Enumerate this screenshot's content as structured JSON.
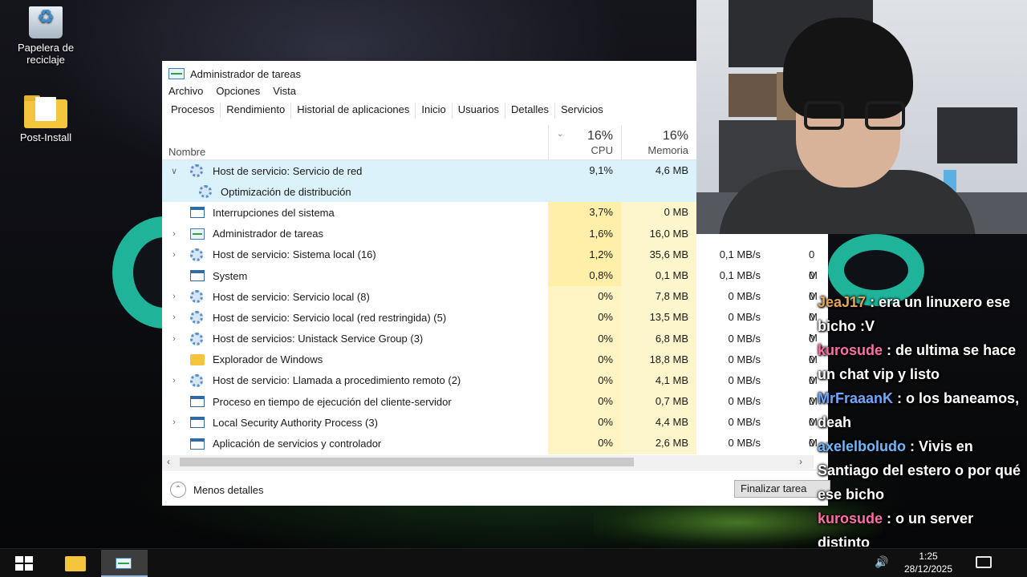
{
  "desktop": {
    "icons": [
      {
        "label": "Papelera de reciclaje",
        "icon": "recycle-bin-icon"
      },
      {
        "label": "Post-Install",
        "icon": "folder-icon"
      }
    ]
  },
  "taskmgr": {
    "title": "Administrador de tareas",
    "menu": [
      "Archivo",
      "Opciones",
      "Vista"
    ],
    "tabs": [
      "Procesos",
      "Rendimiento",
      "Historial de aplicaciones",
      "Inicio",
      "Usuarios",
      "Detalles",
      "Servicios"
    ],
    "active_tab": "Procesos",
    "columns": {
      "name": "Nombre",
      "cpu_pct": "16%",
      "cpu_label": "CPU",
      "mem_pct": "16%",
      "mem_label": "Memoria"
    },
    "rows": [
      {
        "expand": "v",
        "icon": "gear-icon",
        "name": "Host de servicio: Servicio de red",
        "cpu": "9,1%",
        "mem": "4,6 MB",
        "disk": "",
        "net": "",
        "state": "selected"
      },
      {
        "expand": "",
        "icon": "gear-icon",
        "name": "Optimización de distribución",
        "cpu": "",
        "mem": "",
        "disk": "",
        "net": "",
        "state": "sub"
      },
      {
        "expand": "",
        "icon": "window-icon",
        "name": "Interrupciones del sistema",
        "cpu": "3,7%",
        "mem": "0 MB",
        "disk": "",
        "net": "",
        "state": ""
      },
      {
        "expand": ">",
        "icon": "taskmgr-icon",
        "name": "Administrador de tareas",
        "cpu": "1,6%",
        "mem": "16,0 MB",
        "disk": "",
        "net": "",
        "state": ""
      },
      {
        "expand": ">",
        "icon": "gear-icon",
        "name": "Host de servicio: Sistema local (16)",
        "cpu": "1,2%",
        "mem": "35,6 MB",
        "disk": "0,1 MB/s",
        "net": "0 M",
        "state": ""
      },
      {
        "expand": "",
        "icon": "window-icon",
        "name": "System",
        "cpu": "0,8%",
        "mem": "0,1 MB",
        "disk": "0,1 MB/s",
        "net": "0 M",
        "state": ""
      },
      {
        "expand": ">",
        "icon": "gear-icon",
        "name": "Host de servicio: Servicio local (8)",
        "cpu": "0%",
        "mem": "7,8 MB",
        "disk": "0 MB/s",
        "net": "0 M",
        "state": ""
      },
      {
        "expand": ">",
        "icon": "gear-icon",
        "name": "Host de servicio: Servicio local (red restringida) (5)",
        "cpu": "0%",
        "mem": "13,5 MB",
        "disk": "0 MB/s",
        "net": "0 M",
        "state": ""
      },
      {
        "expand": ">",
        "icon": "gear-icon",
        "name": "Host de servicios: Unistack Service Group (3)",
        "cpu": "0%",
        "mem": "6,8 MB",
        "disk": "0 MB/s",
        "net": "0 M",
        "state": ""
      },
      {
        "expand": "",
        "icon": "folder-icon",
        "name": "Explorador de Windows",
        "cpu": "0%",
        "mem": "18,8 MB",
        "disk": "0 MB/s",
        "net": "0 M",
        "state": ""
      },
      {
        "expand": ">",
        "icon": "gear-icon",
        "name": "Host de servicio: Llamada a procedimiento remoto (2)",
        "cpu": "0%",
        "mem": "4,1 MB",
        "disk": "0 MB/s",
        "net": "0 M",
        "state": ""
      },
      {
        "expand": "",
        "icon": "window-icon",
        "name": "Proceso en tiempo de ejecución del cliente-servidor",
        "cpu": "0%",
        "mem": "0,7 MB",
        "disk": "0 MB/s",
        "net": "0 M",
        "state": ""
      },
      {
        "expand": ">",
        "icon": "window-icon",
        "name": "Local Security Authority Process (3)",
        "cpu": "0%",
        "mem": "4,4 MB",
        "disk": "0 MB/s",
        "net": "0 M",
        "state": ""
      },
      {
        "expand": "",
        "icon": "window-icon",
        "name": "Aplicación de servicios y controlador",
        "cpu": "0%",
        "mem": "2,6 MB",
        "disk": "0 MB/s",
        "net": "0 M",
        "state": ""
      }
    ],
    "footer": {
      "less_details": "Menos detalles",
      "end_task": "Finalizar tarea"
    }
  },
  "chat": [
    {
      "user": "JeaJ17",
      "color": "#e8a55a",
      "text": "era un linuxero ese bicho :V"
    },
    {
      "user": "kurosude",
      "color": "#ff6fa8",
      "text": "de ultima se hace un chat vip y listo"
    },
    {
      "user": "MrFraaanK",
      "color": "#6fa8ff",
      "text": "o los baneamos, deah"
    },
    {
      "user": "axelelboludo",
      "color": "#6fb8ff",
      "text": "Vivis en Santiago del estero o por qué ese bicho"
    },
    {
      "user": "kurosude",
      "color": "#ff6fa8",
      "text": "o un server distinto"
    }
  ],
  "taskbar": {
    "time": "1:25",
    "date": "28/12/2025"
  }
}
